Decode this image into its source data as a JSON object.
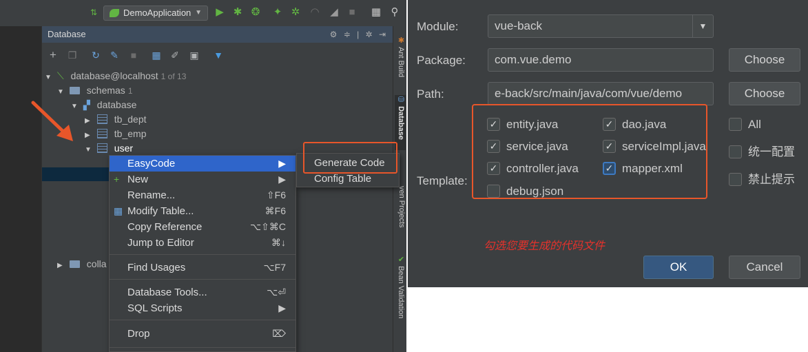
{
  "toolbar": {
    "run_config": "DemoApplication"
  },
  "database_panel": {
    "title": "Database",
    "tree": {
      "root": {
        "label": "database@localhost",
        "count": "1 of 13"
      },
      "schemas": {
        "label": "schemas",
        "count": "1"
      },
      "database": {
        "label": "database"
      },
      "tables": [
        "tb_dept",
        "tb_emp",
        "user"
      ],
      "collapsed_folder": "colla"
    }
  },
  "side_tabs": {
    "ant_build": "Ant Build",
    "database": "Database",
    "maven_projects": "ven Projects",
    "bean_validation": "Bean Validation"
  },
  "context_menu": {
    "items": [
      {
        "label": "EasyCode",
        "shortcut": "▶"
      },
      {
        "label": "New",
        "shortcut": "▶"
      },
      {
        "label": "Rename...",
        "shortcut": "⇧F6"
      },
      {
        "label": "Modify Table...",
        "shortcut": "⌘F6"
      },
      {
        "label": "Copy Reference",
        "shortcut": "⌥⇧⌘C"
      },
      {
        "label": "Jump to Editor",
        "shortcut": "⌘↓"
      },
      {
        "label": "Find Usages",
        "shortcut": "⌥F7"
      },
      {
        "label": "Database Tools...",
        "shortcut": "⌥⏎"
      },
      {
        "label": "SQL Scripts",
        "shortcut": "▶"
      },
      {
        "label": "Drop",
        "shortcut": "⌦"
      }
    ]
  },
  "easycode_submenu": {
    "items": [
      "Generate Code",
      "Config Table"
    ]
  },
  "dialog": {
    "module_label": "Module:",
    "module_value": "vue-back",
    "package_label": "Package:",
    "package_value": "com.vue.demo",
    "path_label": "Path:",
    "path_value": "e-back/src/main/java/com/vue/demo",
    "choose_label": "Choose",
    "template_label": "Template:",
    "templates": [
      {
        "label": "entity.java",
        "checked": "✓"
      },
      {
        "label": "dao.java",
        "checked": "✓"
      },
      {
        "label": "service.java",
        "checked": "✓"
      },
      {
        "label": "serviceImpl.java",
        "checked": "✓"
      },
      {
        "label": "controller.java",
        "checked": "✓"
      },
      {
        "label": "mapper.xml",
        "checked": "✓"
      },
      {
        "label": "debug.json",
        "checked": ""
      }
    ],
    "options": [
      {
        "label": "All"
      },
      {
        "label": "统一配置"
      },
      {
        "label": "禁止提示"
      }
    ],
    "ok_label": "OK",
    "cancel_label": "Cancel",
    "annotation": "勾选您要生成的代码文件"
  },
  "colors": {
    "ide_background": "#3c3f41",
    "highlight_frame": "#e8562a",
    "menu_selection": "#2f65ca",
    "annotation_text": "#e5322c",
    "primary_button": "#365880"
  }
}
